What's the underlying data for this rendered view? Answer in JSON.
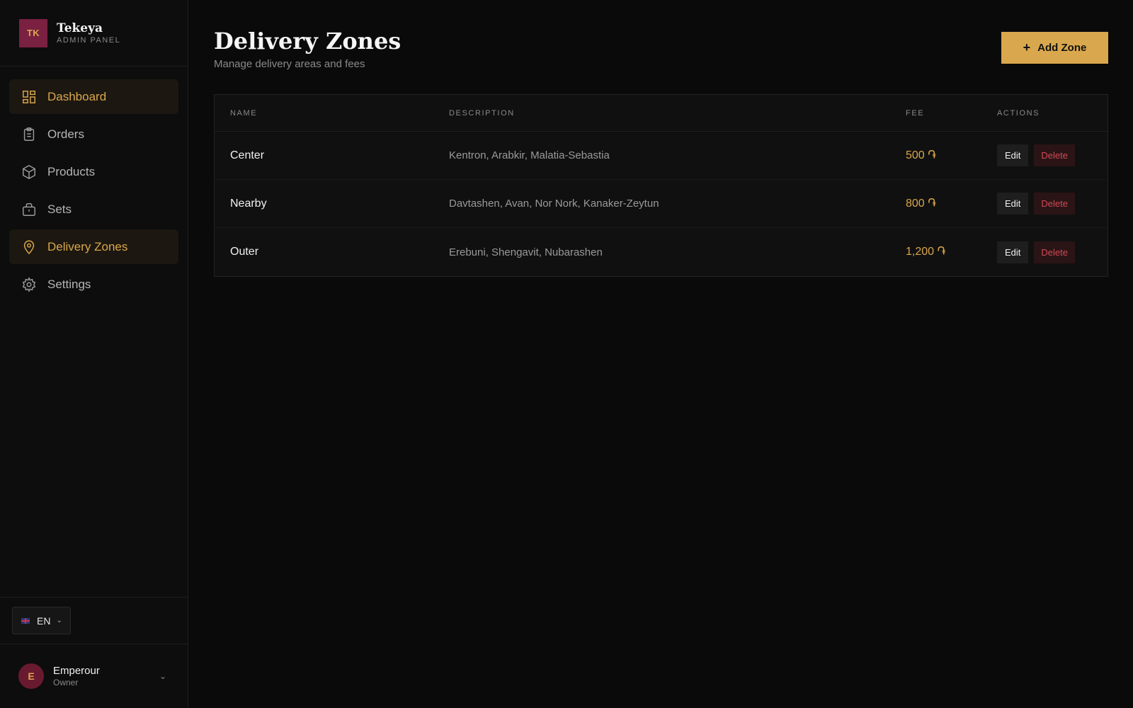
{
  "brand": {
    "logo_text": "TK",
    "name": "Tekeya",
    "subtitle": "ADMIN PANEL"
  },
  "sidebar": {
    "items": [
      {
        "label": "Dashboard",
        "icon": "grid-icon",
        "active": true
      },
      {
        "label": "Orders",
        "icon": "clipboard-icon",
        "active": false
      },
      {
        "label": "Products",
        "icon": "box-icon",
        "active": false
      },
      {
        "label": "Sets",
        "icon": "briefcase-icon",
        "active": false
      },
      {
        "label": "Delivery Zones",
        "icon": "map-pin-icon",
        "active": true
      },
      {
        "label": "Settings",
        "icon": "gear-icon",
        "active": false
      }
    ]
  },
  "language": {
    "selected": "EN"
  },
  "user": {
    "initial": "E",
    "name": "Emperour",
    "role": "Owner"
  },
  "header": {
    "title": "Delivery Zones",
    "subtitle": "Manage delivery areas and fees",
    "add_button": "Add Zone"
  },
  "table": {
    "columns": [
      "NAME",
      "DESCRIPTION",
      "FEE",
      "ACTIONS"
    ],
    "rows": [
      {
        "name": "Center",
        "description": "Kentron, Arabkir, Malatia-Sebastia",
        "fee": "500 ֏",
        "edit": "Edit",
        "delete": "Delete"
      },
      {
        "name": "Nearby",
        "description": "Davtashen, Avan, Nor Nork, Kanaker-Zeytun",
        "fee": "800 ֏",
        "edit": "Edit",
        "delete": "Delete"
      },
      {
        "name": "Outer",
        "description": "Erebuni, Shengavit, Nubarashen",
        "fee": "1,200 ֏",
        "edit": "Edit",
        "delete": "Delete"
      }
    ]
  },
  "colors": {
    "accent": "#d9a74d",
    "brand": "#7a2040",
    "danger": "#d24a55",
    "background": "#0a0a0a"
  }
}
